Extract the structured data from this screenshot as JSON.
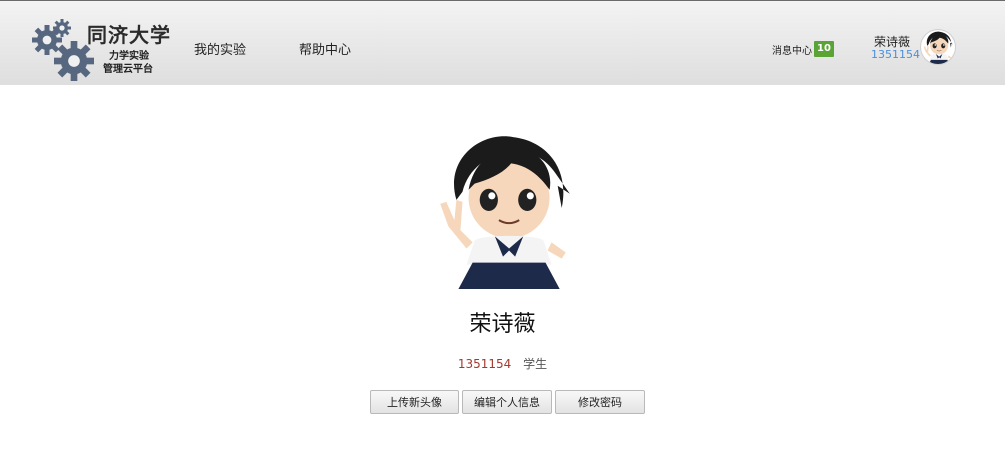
{
  "header": {
    "logo": {
      "title": "同济大学",
      "subtitle_line1": "力学实验",
      "subtitle_line2": "管理云平台",
      "icon": "gears-logo-icon"
    },
    "nav": [
      {
        "label": "我的实验"
      },
      {
        "label": "帮助中心"
      }
    ],
    "messages": {
      "label": "消息中心",
      "count": "10",
      "badge_color": "#5aa335"
    },
    "user": {
      "name": "荣诗薇",
      "id": "1351154",
      "avatar_icon": "user-avatar-icon"
    }
  },
  "profile": {
    "name": "荣诗薇",
    "student_id": "1351154",
    "role": "学生",
    "avatar_icon": "profile-avatar-icon",
    "buttons": [
      {
        "label": "上传新头像"
      },
      {
        "label": "编辑个人信息"
      },
      {
        "label": "修改密码"
      }
    ]
  },
  "colors": {
    "header_bg": "#e6e6e6",
    "id_link": "#4a90d9",
    "profile_id": "#a33a2e"
  }
}
